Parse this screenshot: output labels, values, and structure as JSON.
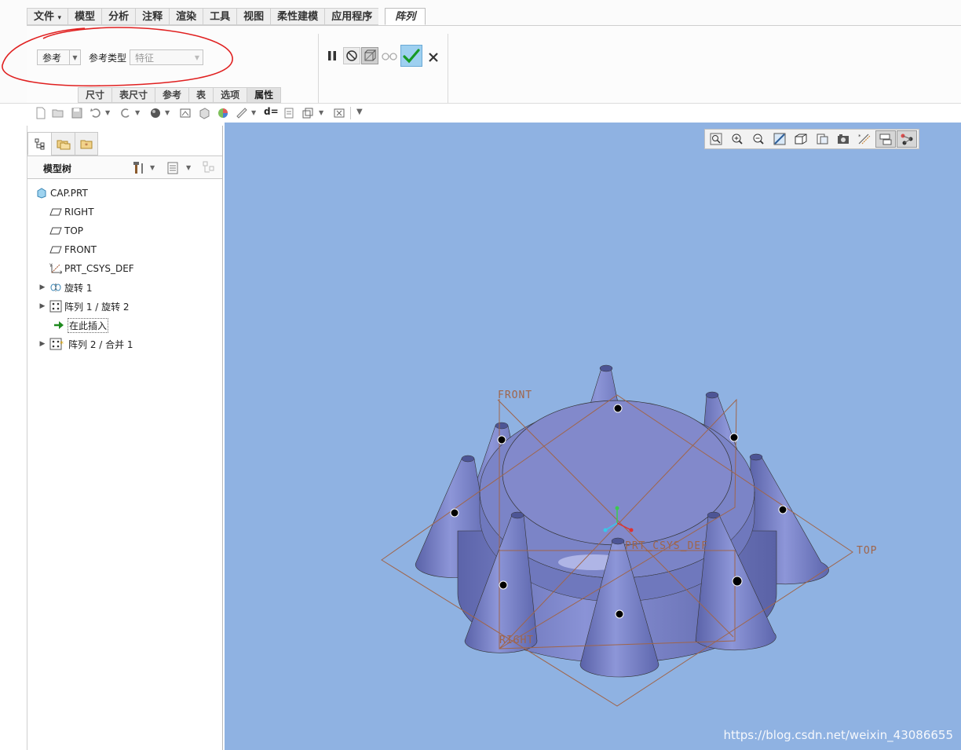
{
  "ribbon": {
    "tabs": [
      "文件",
      "模型",
      "分析",
      "注释",
      "渲染",
      "工具",
      "视图",
      "柔性建模",
      "应用程序"
    ],
    "file_arrow": "▾",
    "active_tab": "阵列",
    "reference_combo": "参考",
    "reference_type_label": "参考类型",
    "reference_type_combo": "特征",
    "subtabs": [
      "尺寸",
      "表尺寸",
      "参考",
      "表",
      "选项",
      "属性"
    ],
    "active_subtab": "属性",
    "commands": [
      "pause",
      "no-preview",
      "preview-box",
      "glasses-preview",
      "ok",
      "cancel"
    ]
  },
  "model_tree": {
    "title": "模型树",
    "items": [
      {
        "label": "CAP.PRT",
        "icon": "part-icon"
      },
      {
        "label": "RIGHT",
        "icon": "datum-plane-icon"
      },
      {
        "label": "TOP",
        "icon": "datum-plane-icon"
      },
      {
        "label": "FRONT",
        "icon": "datum-plane-icon"
      },
      {
        "label": "PRT_CSYS_DEF",
        "icon": "csys-icon"
      },
      {
        "label": "旋转 1",
        "icon": "revolve-icon",
        "expandable": true
      },
      {
        "label": "阵列 1 / 旋转 2",
        "icon": "pattern-icon",
        "expandable": true
      },
      {
        "label": "在此插入",
        "icon": "insert-here-icon"
      },
      {
        "label": "阵列 2 / 合并 1",
        "icon": "pattern-icon",
        "expandable": true
      }
    ]
  },
  "viewport": {
    "datum_labels": {
      "front": "FRONT",
      "top": "TOP",
      "right": "RIGHT",
      "csys": "PRT_CSYS_DEF"
    },
    "watermark": "https://blog.csdn.net/weixin_43086655",
    "background": "#8fb2e2",
    "model_color": "#7a83c4",
    "datum_color": "#a0654a"
  }
}
